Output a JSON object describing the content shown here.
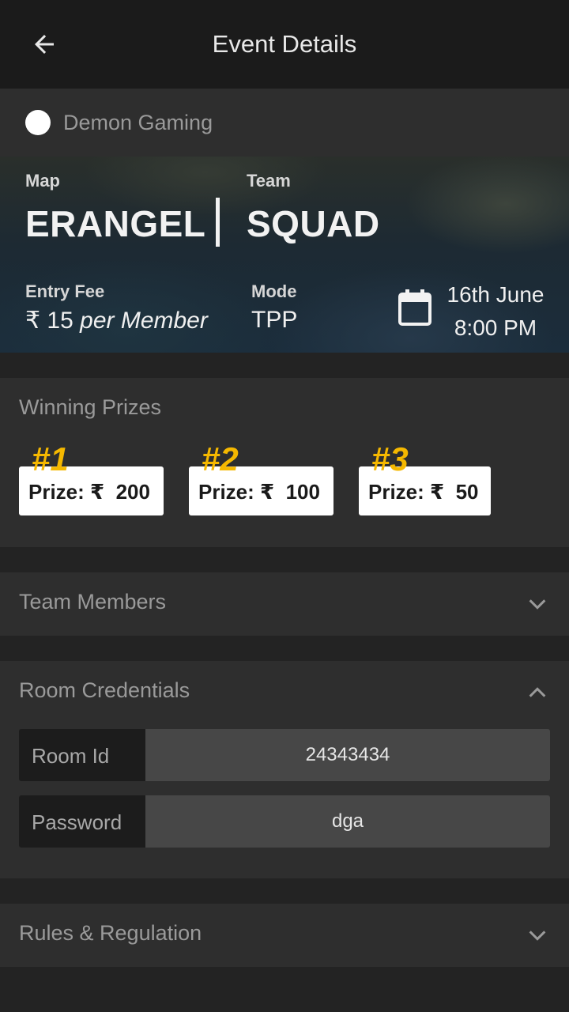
{
  "appbar": {
    "title": "Event Details"
  },
  "organizer": {
    "name": "Demon Gaming"
  },
  "event": {
    "map_label": "Map",
    "map_value": "ERANGEL",
    "team_label": "Team",
    "team_value": "SQUAD",
    "entry_fee_label": "Entry Fee",
    "entry_fee_amount": "₹ 15",
    "entry_fee_suffix": "per Member",
    "mode_label": "Mode",
    "mode_value": "TPP",
    "date": "16th June",
    "time": "8:00 PM"
  },
  "prizes": {
    "title": "Winning Prizes",
    "items": [
      {
        "rank": "#1",
        "text": "Prize: ₹  200"
      },
      {
        "rank": "#2",
        "text": "Prize: ₹  100"
      },
      {
        "rank": "#3",
        "text": "Prize: ₹  50"
      }
    ],
    "rank_color": "#f5b800"
  },
  "team_members": {
    "title": "Team Members",
    "expanded": false
  },
  "room_credentials": {
    "title": "Room Credentials",
    "expanded": true,
    "room_id_label": "Room Id",
    "room_id_value": "24343434",
    "password_label": "Password",
    "password_value": "dga"
  },
  "rules": {
    "title": "Rules & Regulation",
    "expanded": false
  },
  "icons": {
    "back": "arrow-back-icon",
    "calendar": "calendar-icon",
    "chevron_down": "chevron-down-icon",
    "chevron_up": "chevron-up-icon"
  }
}
